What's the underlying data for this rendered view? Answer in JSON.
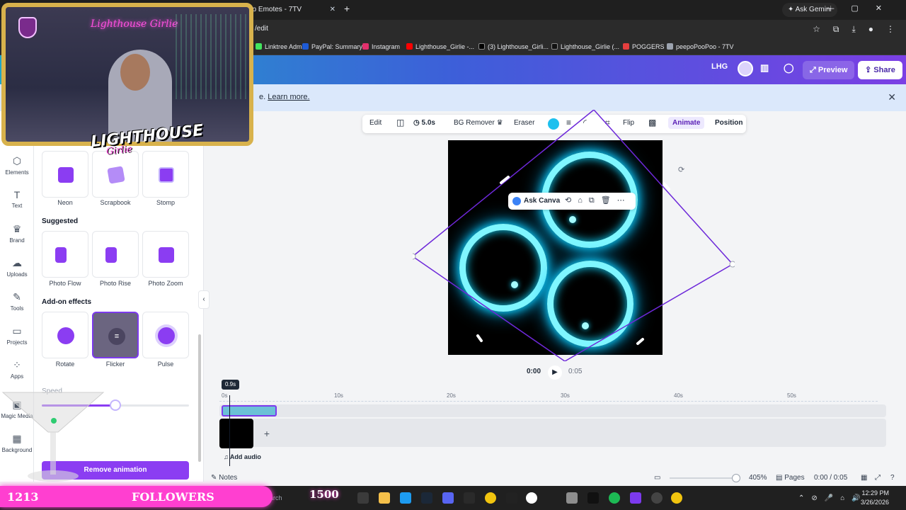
{
  "browser": {
    "tab_title": "Top Emotes - 7TV",
    "url": "/edit",
    "ask_gemini": "Ask Gemini",
    "bookmarks": [
      "Linktree Admin",
      "PayPal: Summary",
      "Instagram",
      "Lighthouse_Girlie -...",
      "(3) Lighthouse_Girli...",
      "Lighthouse_Girlie (...",
      "POGGERS",
      "peepoPooPoo - 7TV"
    ]
  },
  "header": {
    "team": "LHG",
    "preview": "Preview",
    "share": "Share"
  },
  "banner": {
    "text_prefix": "e.",
    "link": "Learn more."
  },
  "leftnav": [
    "Elements",
    "Text",
    "Brand",
    "Uploads",
    "Tools",
    "Projects",
    "Apps",
    "Magic Media",
    "Background"
  ],
  "panel": {
    "row1": [
      "Neon",
      "Scrapbook",
      "Stomp"
    ],
    "suggested_title": "Suggested",
    "suggested": [
      "Photo Flow",
      "Photo Rise",
      "Photo Zoom"
    ],
    "addon_title": "Add-on effects",
    "addons": [
      "Rotate",
      "Flicker",
      "Pulse"
    ],
    "speed_label": "Speed",
    "speed_value": 0.5,
    "remove_label": "Remove animation"
  },
  "toolbar": {
    "edit": "Edit",
    "duration": "5.0s",
    "bg_remover": "BG Remover",
    "eraser": "Eraser",
    "flip": "Flip",
    "animate": "Animate",
    "position": "Position",
    "color": "#1ec0ee"
  },
  "ask_canva": "Ask Canva",
  "playback": {
    "current": "0:00",
    "total": "0:05"
  },
  "timeline": {
    "badge": "0.9s",
    "ticks": [
      "0s",
      "10s",
      "20s",
      "30s",
      "40s",
      "50s"
    ],
    "add_audio": "Add audio"
  },
  "bottom": {
    "notes": "Notes",
    "zoom": "405%",
    "pages": "Pages",
    "time": "0:00 / 0:05"
  },
  "taskbar": {
    "search": "Search",
    "time": "12:29 PM",
    "date": "3/26/2026"
  },
  "overlay": {
    "cam_neon": "Lighthouse Girlie",
    "logo_word": "LIGHTHOUSE",
    "logo_sub": "Girlie",
    "followers_count": "1213",
    "followers_label": "FOLLOWERS",
    "goal": "1500"
  }
}
